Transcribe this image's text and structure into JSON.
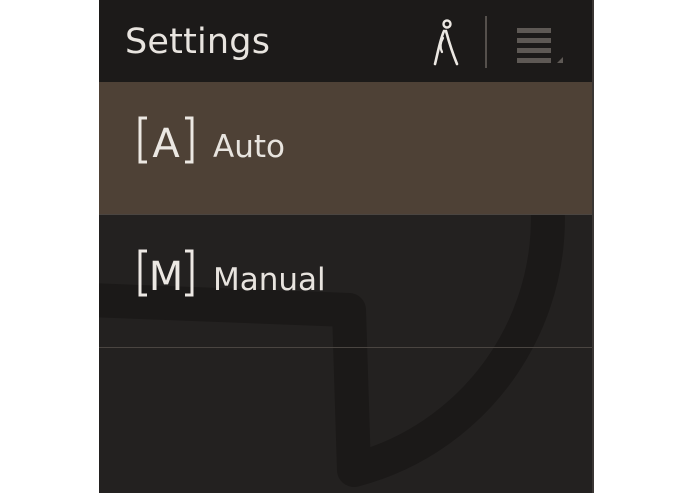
{
  "header": {
    "title": "Settings",
    "walker_icon": "pedestrian-icon",
    "menu_icon": "hamburger-menu-icon"
  },
  "menu": {
    "items": [
      {
        "badge": "A",
        "label": "Auto",
        "selected": true,
        "icon": "auto-mode-icon"
      },
      {
        "badge": "M",
        "label": "Manual",
        "selected": false,
        "icon": "manual-mode-icon"
      }
    ]
  },
  "colors": {
    "panel_bg": "#232120",
    "header_bg": "#1c1a19",
    "selected_bg": "#4e4136",
    "text": "#e8e4df"
  }
}
